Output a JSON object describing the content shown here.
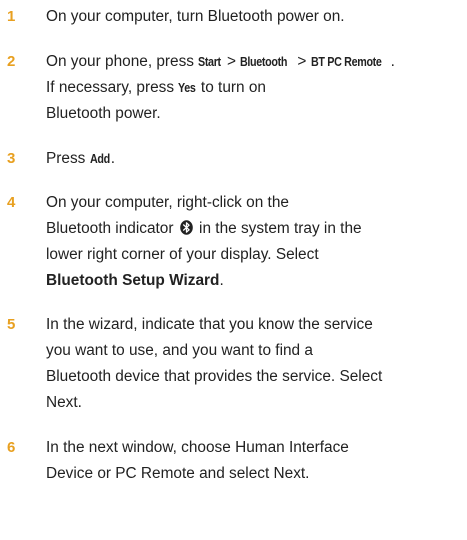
{
  "accent_color": "#e8a020",
  "text_color": "#222222",
  "steps": [
    {
      "number": "1",
      "lines": [
        "On your computer, turn Bluetooth power on."
      ]
    },
    {
      "number": "2",
      "line1_prefix": "On your phone, press ",
      "ui_start": "Start",
      "sep": " > ",
      "ui_bluetooth": "Bluetooth",
      "ui_bt_pc_remote": "BT PC Remote",
      "line1_end": ".",
      "line2_prefix": "If necessary, press ",
      "ui_yes": "Yes",
      "line2_suffix": " to turn on",
      "line3": "Bluetooth power."
    },
    {
      "number": "3",
      "prefix": "Press ",
      "ui_add": "Add",
      "suffix": "."
    },
    {
      "number": "4",
      "line1": "On your computer, right-click on the",
      "line2_prefix": "Bluetooth indicator ",
      "icon": "bluetooth-icon",
      "line2_suffix": " in the system tray in the",
      "line3": "lower right corner of your display. Select",
      "bold_label": "Bluetooth Setup Wizard",
      "bold_suffix": "."
    },
    {
      "number": "5",
      "lines": [
        "In the wizard, indicate that you know the service",
        "you want to use, and you want to find a",
        "Bluetooth device that provides the service. Select",
        "Next."
      ]
    },
    {
      "number": "6",
      "lines": [
        "In the next window, choose Human Interface",
        "Device or PC Remote and select Next."
      ]
    }
  ]
}
